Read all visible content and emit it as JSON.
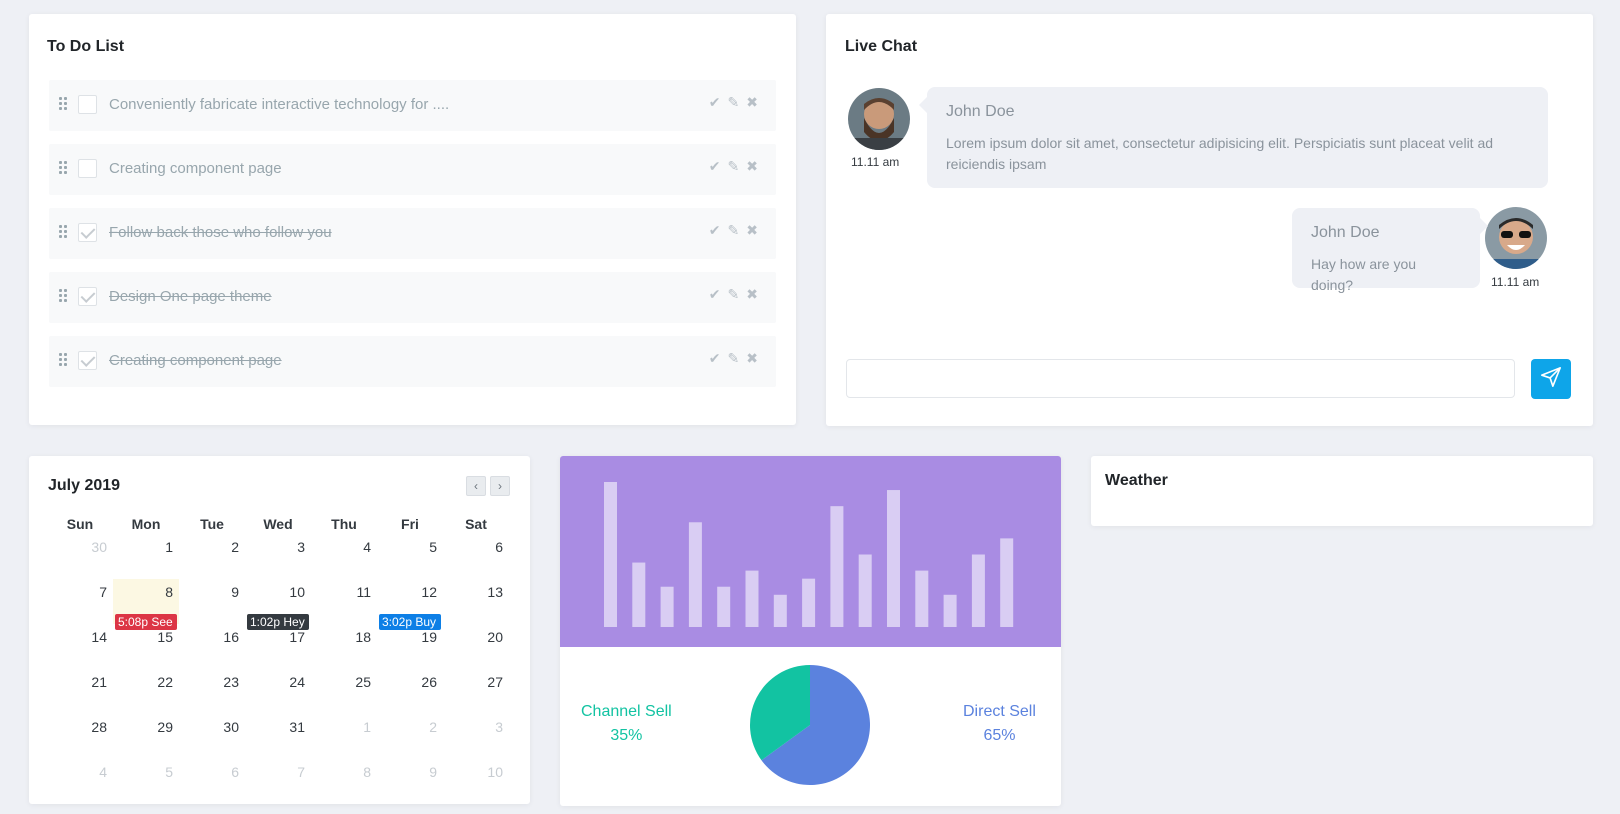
{
  "todo": {
    "title": "To Do List",
    "items": [
      {
        "text": "Conveniently fabricate interactive technology for ....",
        "done": false
      },
      {
        "text": "Creating component page",
        "done": false
      },
      {
        "text": "Follow back those who follow you",
        "done": true
      },
      {
        "text": "Design One page theme",
        "done": true
      },
      {
        "text": "Creating component page",
        "done": true
      }
    ],
    "actions": {
      "complete_icon": "check-icon",
      "edit_icon": "pencil-icon",
      "delete_icon": "close-icon"
    }
  },
  "chat": {
    "title": "Live Chat",
    "messages": [
      {
        "name": "John Doe",
        "text": "Lorem ipsum dolor sit amet, consectetur adipisicing elit. Perspiciatis sunt placeat velit ad reiciendis ipsam",
        "time": "11.11 am",
        "side": "left"
      },
      {
        "name": "John Doe",
        "text": "Hay how are you doing?",
        "time": "11.11 am",
        "side": "right"
      }
    ],
    "input_placeholder": "",
    "send_icon": "send-icon"
  },
  "calendar": {
    "title": "July 2019",
    "prev_icon": "chevron-left-icon",
    "next_icon": "chevron-right-icon",
    "weekdays": [
      "Sun",
      "Mon",
      "Tue",
      "Wed",
      "Thu",
      "Fri",
      "Sat"
    ],
    "weeks": [
      [
        {
          "n": "30",
          "o": true
        },
        {
          "n": "1"
        },
        {
          "n": "2"
        },
        {
          "n": "3"
        },
        {
          "n": "4"
        },
        {
          "n": "5"
        },
        {
          "n": "6"
        }
      ],
      [
        {
          "n": "7"
        },
        {
          "n": "8",
          "today": true,
          "event": "5:08p See",
          "color": "#dc3545"
        },
        {
          "n": "9"
        },
        {
          "n": "10",
          "event": "1:02p Hey",
          "color": "#343a40"
        },
        {
          "n": "11"
        },
        {
          "n": "12",
          "event": "3:02p Buy",
          "color": "#0d7fe6"
        },
        {
          "n": "13"
        }
      ],
      [
        {
          "n": "14"
        },
        {
          "n": "15"
        },
        {
          "n": "16"
        },
        {
          "n": "17"
        },
        {
          "n": "18"
        },
        {
          "n": "19"
        },
        {
          "n": "20"
        }
      ],
      [
        {
          "n": "21"
        },
        {
          "n": "22"
        },
        {
          "n": "23"
        },
        {
          "n": "24"
        },
        {
          "n": "25"
        },
        {
          "n": "26"
        },
        {
          "n": "27"
        }
      ],
      [
        {
          "n": "28"
        },
        {
          "n": "29"
        },
        {
          "n": "30"
        },
        {
          "n": "31"
        },
        {
          "n": "1",
          "o": true
        },
        {
          "n": "2",
          "o": true
        },
        {
          "n": "3",
          "o": true
        }
      ],
      [
        {
          "n": "4",
          "o": true
        },
        {
          "n": "5",
          "o": true
        },
        {
          "n": "6",
          "o": true
        },
        {
          "n": "7",
          "o": true
        },
        {
          "n": "8",
          "o": true
        },
        {
          "n": "9",
          "o": true
        },
        {
          "n": "10",
          "o": true
        }
      ]
    ]
  },
  "chart_data": [
    {
      "type": "bar",
      "background": "#a98ce3",
      "bar_color": "#d9cdf3",
      "values": [
        18,
        8,
        5,
        13,
        5,
        7,
        4,
        6,
        15,
        9,
        17,
        7,
        4,
        9,
        11
      ],
      "ylim": [
        0,
        18
      ]
    },
    {
      "type": "pie",
      "slices": [
        {
          "label": "Channel Sell",
          "value": 35,
          "value_text": "35%",
          "color": "#12c3a2"
        },
        {
          "label": "Direct Sell",
          "value": 65,
          "value_text": "65%",
          "color": "#5b82de"
        }
      ]
    }
  ],
  "weather": {
    "title": "Weather"
  }
}
